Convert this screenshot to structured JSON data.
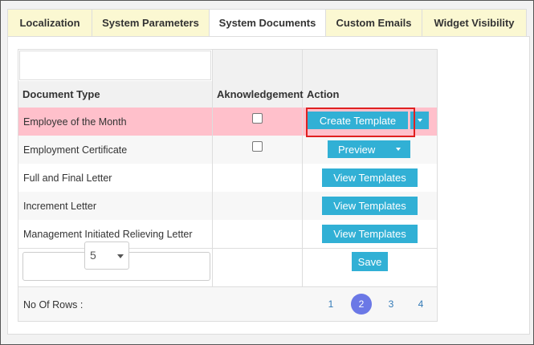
{
  "tabs": [
    {
      "label": "Localization"
    },
    {
      "label": "System Parameters"
    },
    {
      "label": "System Documents"
    },
    {
      "label": "Custom Emails"
    },
    {
      "label": "Widget Visibility"
    }
  ],
  "table": {
    "headers": {
      "document_type": "Document Type",
      "acknowledgement": "Aknowledgement",
      "action": "Action"
    },
    "rows": [
      {
        "name": "Employee of the Month",
        "has_checkbox": true,
        "action": "Create Template"
      },
      {
        "name": "Employment Certificate",
        "has_checkbox": true,
        "action": "Preview"
      },
      {
        "name": "Full and Final Letter",
        "has_checkbox": false,
        "action": "View Templates"
      },
      {
        "name": "Increment Letter",
        "has_checkbox": false,
        "action": "View Templates"
      },
      {
        "name": "Management Initiated Relieving Letter",
        "has_checkbox": false,
        "action": "View Templates"
      }
    ],
    "save_label": "Save"
  },
  "footer": {
    "rows_label": "No Of Rows :",
    "rows_value": "5",
    "pages": [
      "1",
      "2",
      "3",
      "4"
    ],
    "current_page": "2"
  },
  "colors": {
    "accent": "#31b0d5",
    "highlight_row": "#ffc0cb",
    "active_page": "#6b78e6",
    "tab_bg": "#fbf8d2"
  }
}
